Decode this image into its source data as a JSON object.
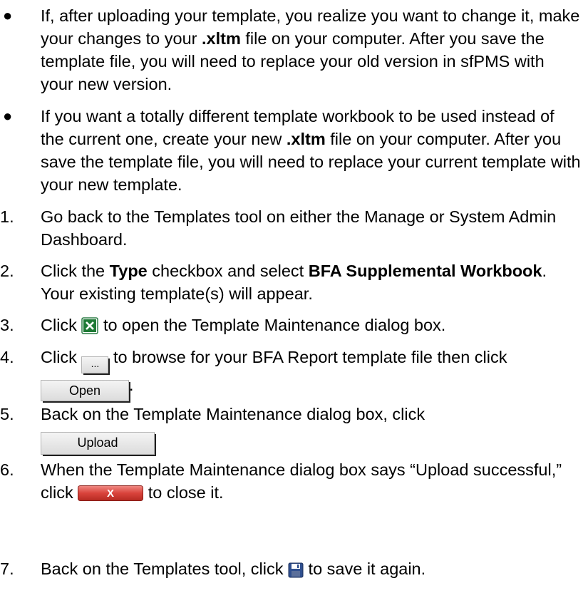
{
  "bullets": [
    {
      "p1": "If, after uploading your template, you realize you want to change it, make your changes to your ",
      "bold1": ".xltm",
      "p2": " file on your computer.  After you save the template file, you will need to replace your old version in sfPMS with your new version."
    },
    {
      "p1": "If you want a totally different template workbook to be used instead of the current one, create your new ",
      "bold1": ".xltm",
      "p2": " file on your computer.   After you save the template file, you will need to replace your current template with your new template."
    }
  ],
  "steps": {
    "s1": {
      "num": "1.",
      "text": "Go back to the Templates tool on either the Manage or System Admin Dashboard."
    },
    "s2": {
      "num": "2.",
      "p1": "Click the ",
      "b1": "Type",
      "p2": " checkbox and select ",
      "b2": "BFA Supplemental Workbook",
      "p3": ".  Your existing template(s) will appear."
    },
    "s3": {
      "num": "3.",
      "p1": "Click ",
      "p2": " to open the Template Maintenance dialog box."
    },
    "s4": {
      "num": "4.",
      "p1": "Click ",
      "p2": " to browse for your BFA Report template file then click ",
      "p3": "."
    },
    "s5": {
      "num": "5.",
      "p1": "Back on the Template Maintenance dialog box, click "
    },
    "s6": {
      "num": "6.",
      "p1": "When the Template Maintenance dialog box says “Upload successful,” click ",
      "p2": " to close it."
    },
    "s7": {
      "num": "7.",
      "p1": "Back on the Templates tool, click ",
      "p2": " to save it again."
    }
  },
  "buttons": {
    "browse_label": "...",
    "open_label": "Open",
    "upload_label": "Upload",
    "close_label": "X"
  },
  "icons": {
    "excel": "excel-icon",
    "browse": "ellipsis-icon",
    "close": "close-icon",
    "save": "floppy-disk-icon"
  },
  "colors": {
    "excel_green": "#1e7a35",
    "close_red": "#c9302c",
    "save_blue": "#2f4f8f"
  }
}
